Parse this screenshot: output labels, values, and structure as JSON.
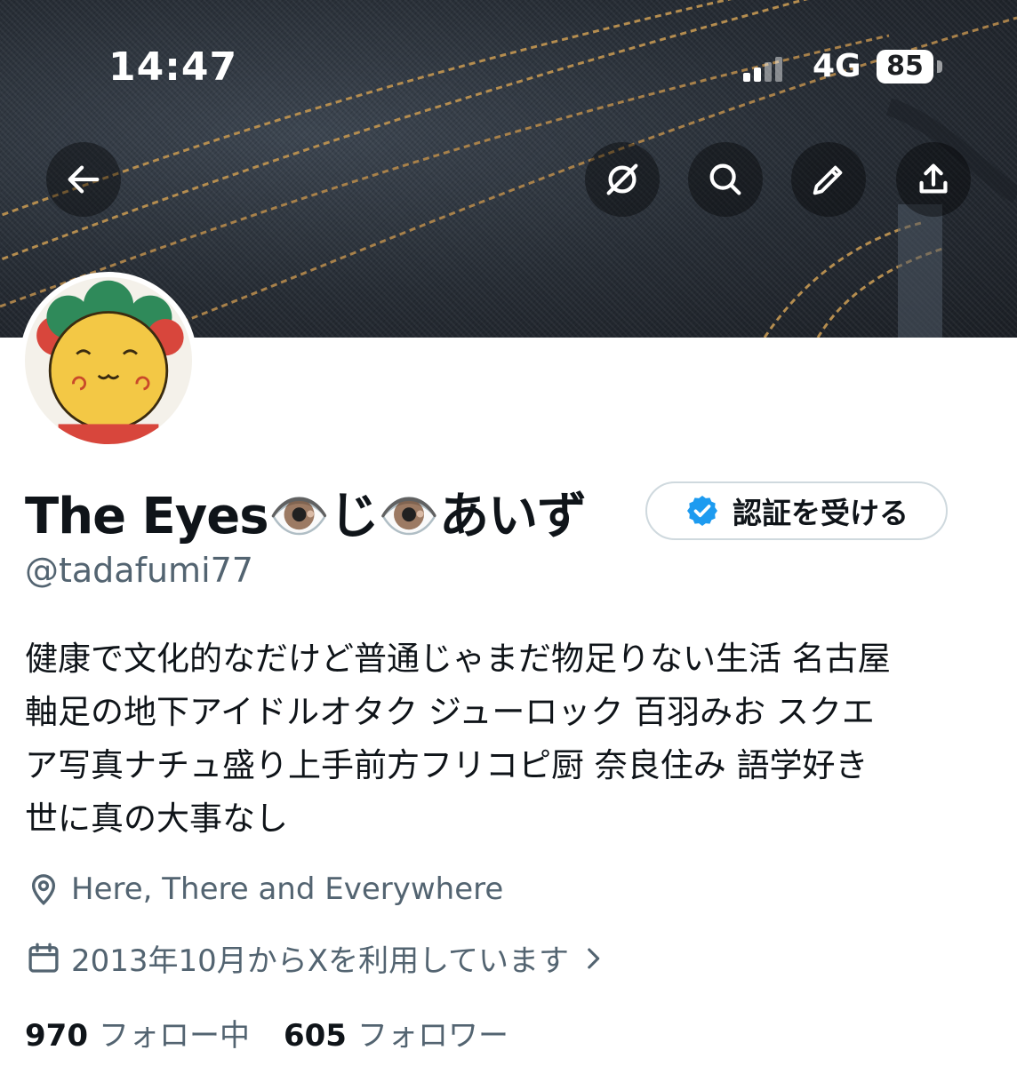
{
  "status_bar": {
    "time": "14:47",
    "network": "4G",
    "battery": "85"
  },
  "header": {
    "back_icon": "arrow-left-icon",
    "actions": [
      "grok-icon",
      "search-icon",
      "edit-pencil-icon",
      "share-icon"
    ]
  },
  "profile": {
    "display_name": "The Eyes👁️じ👁️あいず",
    "verify_button_label": "認証を受ける",
    "handle": "@tadafumi77",
    "bio": "健康で文化的なだけど普通じゃまだ物足りない生活 名古屋\n軸足の地下アイドルオタク ジューロック 百羽みお スクエ\nア写真ナチュ盛り上手前方フリコピ厨 奈良住み 語学好き\n世に真の大事なし",
    "location": "Here, There and Everywhere",
    "joined": "2013年10月からXを利用しています",
    "following_count": "970",
    "following_label": "フォロー中",
    "followers_count": "605",
    "followers_label": "フォロワー"
  },
  "colors": {
    "text_primary": "#0f1419",
    "text_secondary": "#536471",
    "verified_blue": "#1d9bf0",
    "border": "#cfd9de"
  }
}
